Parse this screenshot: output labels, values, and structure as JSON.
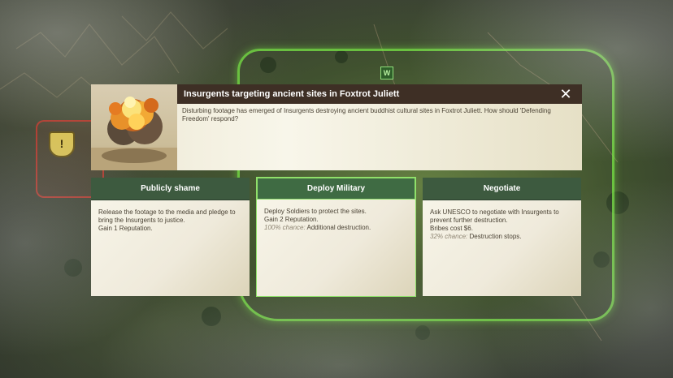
{
  "event": {
    "title": "Insurgents targeting ancient sites in Foxtrot Juliett",
    "description": "Disturbing footage has emerged of Insurgents destroying ancient buddhist cultural sites in Foxtrot Juliett. How should 'Defending Freedom' respond?",
    "close_label": "✕"
  },
  "map": {
    "marker_glyph": "!",
    "unit_label": "W"
  },
  "options": [
    {
      "title": "Publicly shame",
      "lines": [
        "Release the footage to the media and pledge to bring the Insurgents to justice.",
        "Gain 1 Reputation."
      ]
    },
    {
      "title": "Deploy Military",
      "lines": [
        "Deploy Soldiers to protect the sites.",
        "Gain 2 Reputation."
      ],
      "chance": "100% chance:",
      "chance_result": "Additional destruction."
    },
    {
      "title": "Negotiate",
      "lines": [
        "Ask UNESCO to negotiate with Insurgents to prevent further destruction.",
        "Bribes cost $6."
      ],
      "chance": "32% chance:",
      "chance_result": "Destruction stops."
    }
  ],
  "colors": {
    "header_bg": "#3e2f25",
    "option_header_bg": "#3d5a3f",
    "zone_border": "#78e646",
    "enemy_border": "#dc3c32"
  }
}
